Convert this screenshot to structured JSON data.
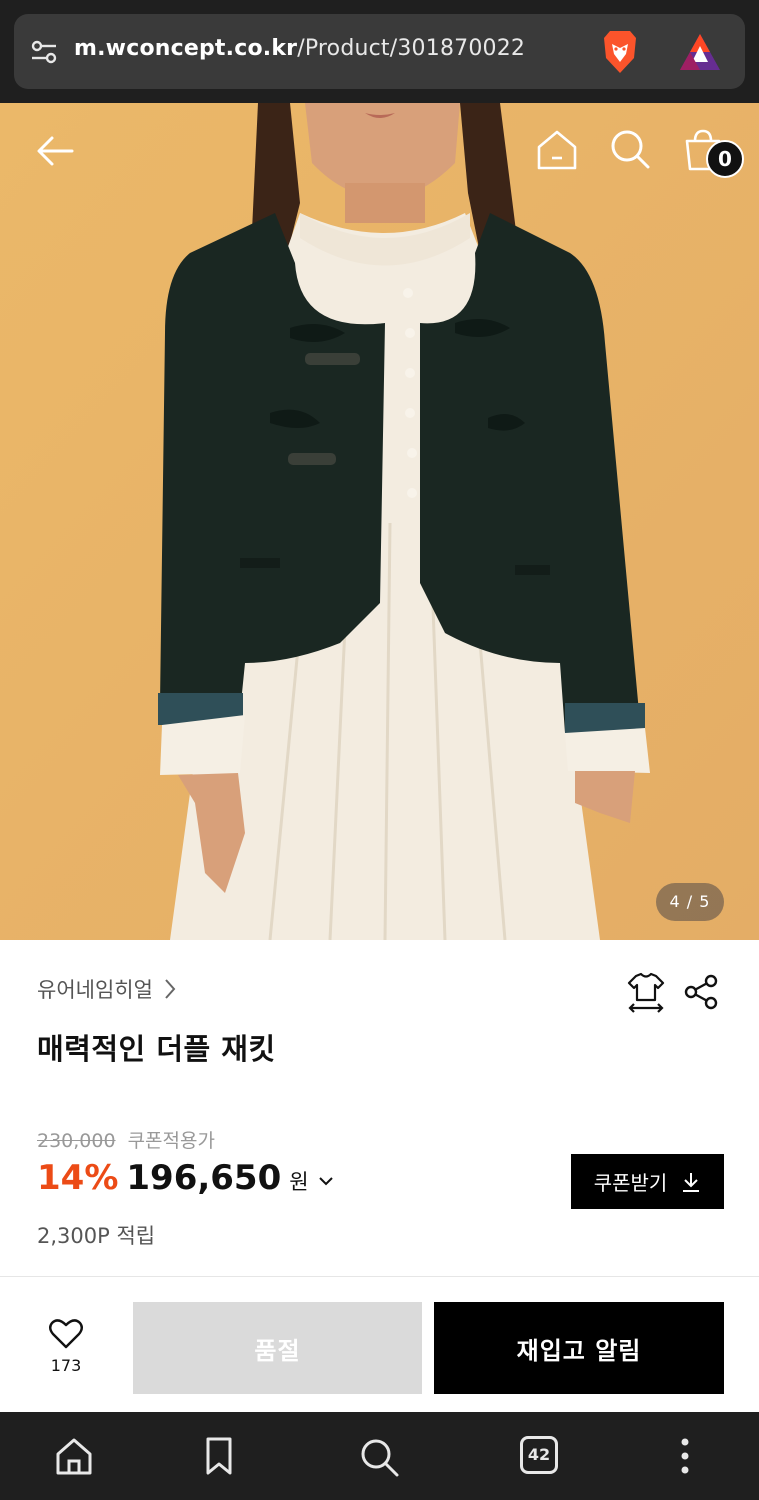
{
  "browser": {
    "url_host": "m.wconcept.co.kr",
    "url_path": "/Product/301870022",
    "tab_count": "42"
  },
  "header": {
    "cart_count": "0",
    "image_counter": "4 / 5"
  },
  "product": {
    "brand": "유어네임히얼",
    "title": "매력적인 더플 재킷",
    "original_price": "230,000",
    "coupon_note": "쿠폰적용가",
    "discount_pct": "14%",
    "price": "196,650",
    "currency": "원",
    "points": "2,300P 적립",
    "coupon_button": "쿠폰받기"
  },
  "actions": {
    "like_count": "173",
    "soldout_label": "품절",
    "notify_label": "재입고 알림"
  },
  "colors": {
    "accent_discount": "#ec4b16",
    "hero_background": "#e8b46a",
    "soldout_bg": "#dadada"
  }
}
